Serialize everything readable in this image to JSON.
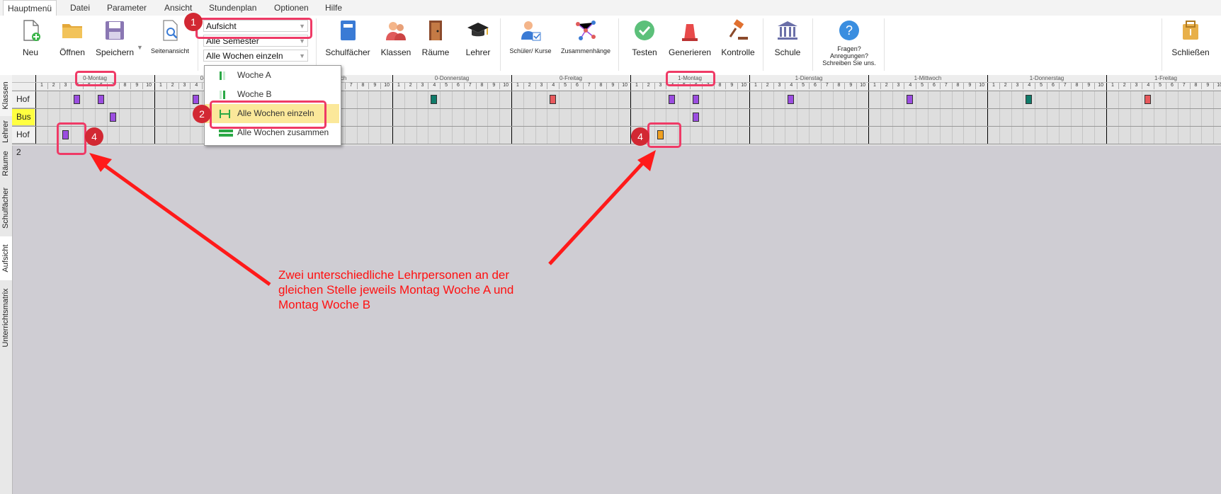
{
  "menubar": {
    "items": [
      {
        "label": "Hauptmenü",
        "active": true
      },
      {
        "label": "Datei"
      },
      {
        "label": "Parameter"
      },
      {
        "label": "Ansicht"
      },
      {
        "label": "Stundenplan"
      },
      {
        "label": "Optionen"
      },
      {
        "label": "Hilfe"
      }
    ]
  },
  "ribbon": {
    "neu": "Neu",
    "oeffnen": "Öffnen",
    "speichern": "Speichern",
    "seitenansicht": "Seitenansicht",
    "combo_view": "Aufsicht",
    "combo_semester": "Alle Semester",
    "combo_weeks": "Alle Wochen einzeln",
    "schulfaecher": "Schulfächer",
    "klassen": "Klassen",
    "raeume": "Räume",
    "lehrer": "Lehrer",
    "schueler_kurse": "Schüler/ Kurse",
    "zusammenhaenge": "Zusammenhänge",
    "testen": "Testen",
    "generieren": "Generieren",
    "kontrolle": "Kontrolle",
    "schule": "Schule",
    "fragen_line1": "Fragen?",
    "fragen_line2": "Anregungen?",
    "fragen_line3": "Schreiben Sie uns.",
    "schliessen": "Schließen"
  },
  "dropdown": {
    "items": [
      {
        "label": "Woche A",
        "color": "#2aa845"
      },
      {
        "label": "Woche B",
        "color": "#2aa845"
      },
      {
        "label": "Alle Wochen einzeln",
        "color": "#2aa845",
        "selected": true
      },
      {
        "label": "Alle Wochen zusammen",
        "color": "#2aa845"
      }
    ]
  },
  "side_tabs": [
    "Klassen",
    "Lehrer",
    "Räume",
    "Schulfächer",
    "Aufsicht",
    "Unterrichtsmatrix"
  ],
  "grid": {
    "days": [
      "0-Montag",
      "0-Dienstag",
      "0-Mittwoch",
      "0-Donnerstag",
      "0-Freitag",
      "1-Montag",
      "1-Dienstag",
      "1-Mittwoch",
      "1-Donnerstag",
      "1-Freitag"
    ],
    "periods": [
      "1",
      "2",
      "3",
      "4",
      "5",
      "6",
      "7",
      "8",
      "9",
      "10"
    ],
    "rows": [
      {
        "label": "Hof",
        "highlight": false
      },
      {
        "label": "Bus",
        "highlight": true
      },
      {
        "label": "Hof 2",
        "highlight": false
      }
    ],
    "colors": {
      "purple": "#9b4de0",
      "teal": "#0f7b6a",
      "red": "#e8585c",
      "orange": "#f0a020",
      "bus_yellow": "#ffff40"
    }
  },
  "callouts": {
    "b1": "1",
    "b2": "2",
    "b4a": "4",
    "b4b": "4"
  },
  "note": {
    "line1": "Zwei unterschiedliche Lehrpersonen an der",
    "line2": "gleichen Stelle jeweils Montag Woche A und",
    "line3": "Montag Woche B"
  }
}
